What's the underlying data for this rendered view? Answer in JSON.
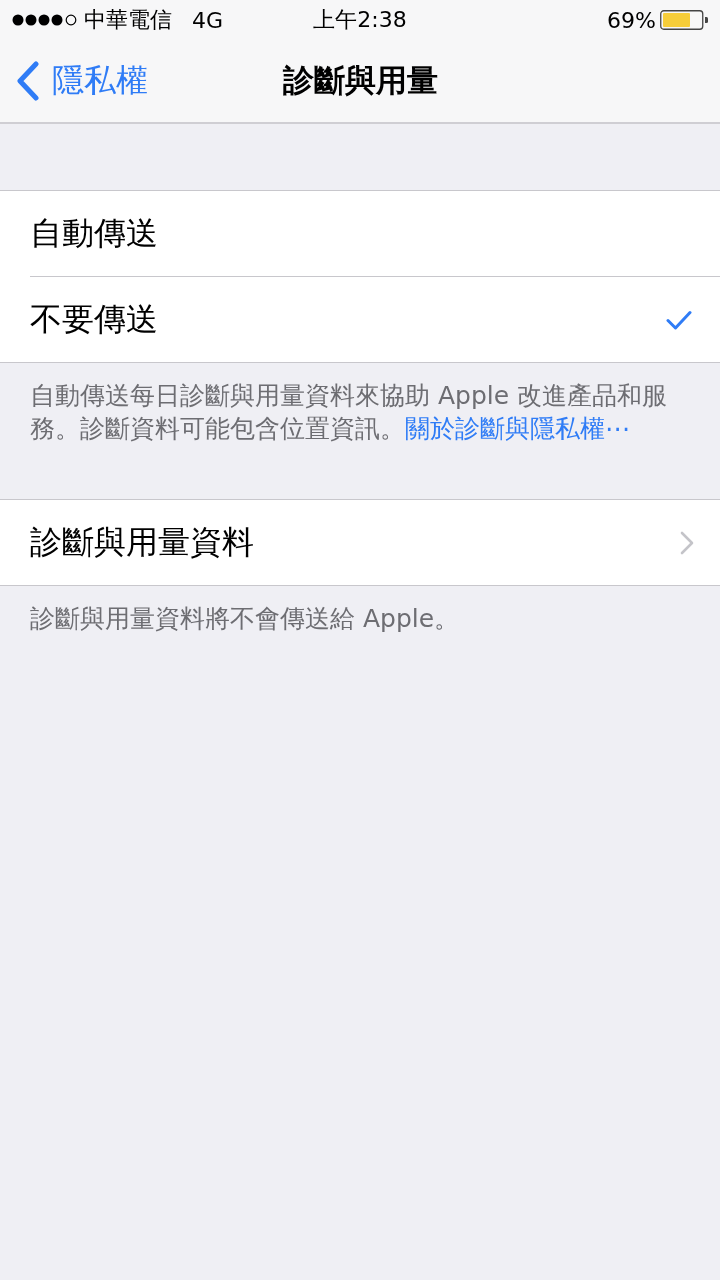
{
  "status_bar": {
    "carrier": "中華電信",
    "network": "4G",
    "time": "上午2:38",
    "battery": "69%"
  },
  "nav_bar": {
    "back": "隱私權",
    "title": "診斷與用量"
  },
  "sections": [
    {
      "kind": "choice",
      "rows": [
        {
          "label": "自動傳送",
          "selected": false
        },
        {
          "label": "不要傳送",
          "selected": true
        }
      ],
      "footer": {
        "text": "自動傳送每日診斷與用量資料來協助 Apple 改進產品和服務。診斷資料可能包含位置資訊。",
        "link": "關於診斷與隱私權⋯"
      }
    },
    {
      "kind": "disclosure",
      "rows": [
        {
          "label": "診斷與用量資料"
        }
      ],
      "footer": {
        "text": "診斷與用量資料將不會傳送給 Apple。"
      }
    }
  ]
}
